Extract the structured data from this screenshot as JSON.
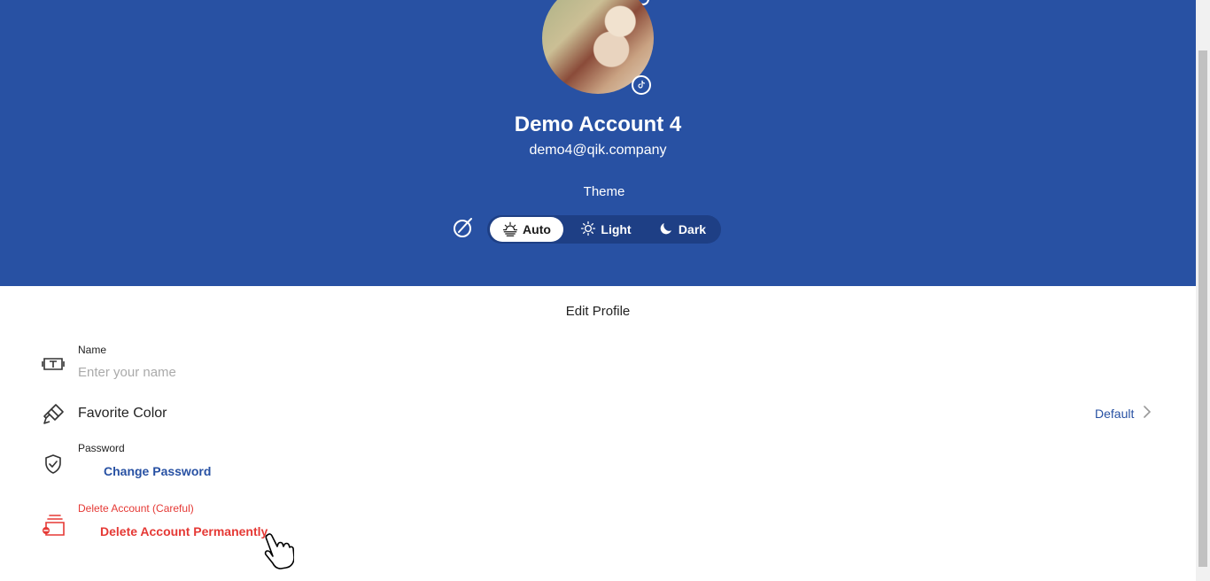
{
  "profile": {
    "name": "Demo Account 4",
    "email": "demo4@qik.company"
  },
  "theme": {
    "label": "Theme",
    "options": [
      {
        "label": "Auto",
        "icon": "sunrise-icon",
        "selected": true
      },
      {
        "label": "Light",
        "icon": "sun-icon",
        "selected": false
      },
      {
        "label": "Dark",
        "icon": "moon-icon",
        "selected": false
      }
    ]
  },
  "edit_profile": {
    "title": "Edit Profile",
    "name_field": {
      "label": "Name",
      "placeholder": "Enter your name",
      "value": ""
    },
    "favorite_color": {
      "label": "Favorite Color",
      "value": "Default"
    },
    "password": {
      "label": "Password",
      "action": "Change Password"
    },
    "delete_account": {
      "label": "Delete Account (Careful)",
      "action": "Delete Account Permanently"
    }
  },
  "colors": {
    "header_bg": "#2851a3",
    "accent": "#2851a3",
    "danger": "#e53935"
  }
}
